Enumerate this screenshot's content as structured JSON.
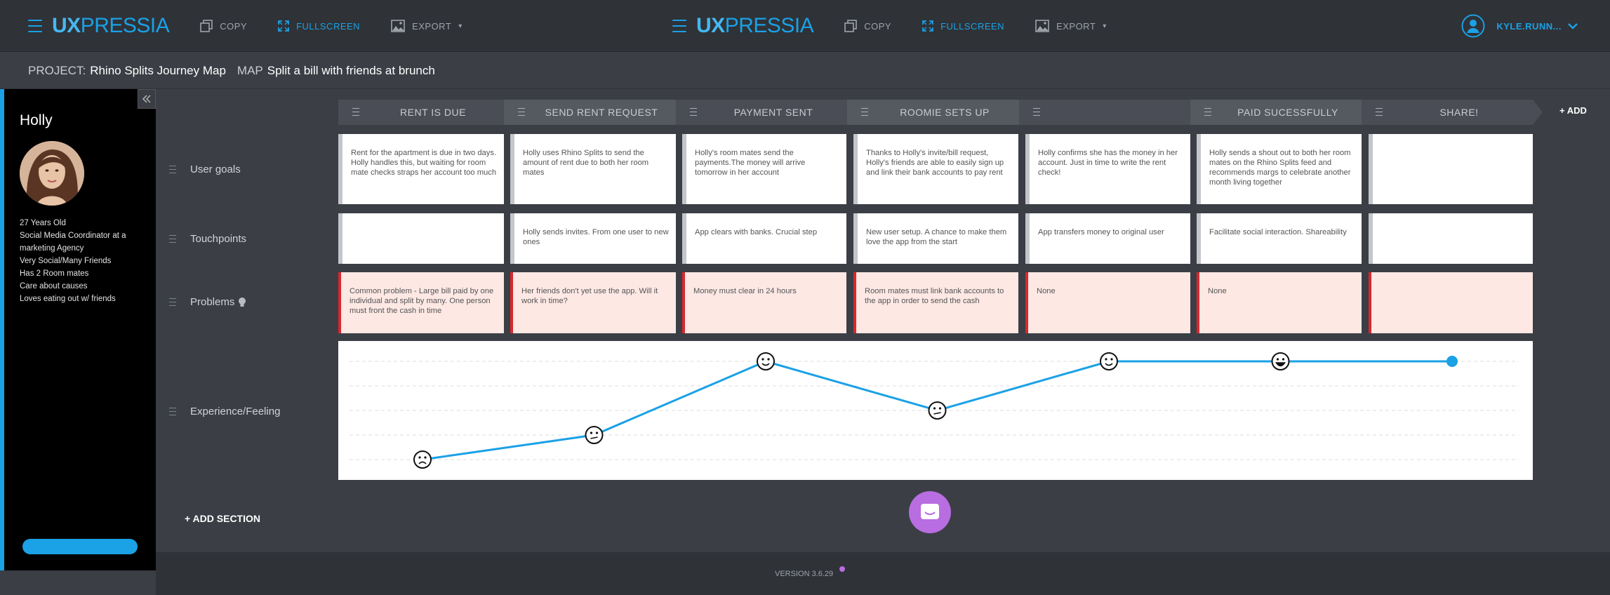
{
  "app": {
    "logo_left": "UX",
    "logo_right": "PRESSIA"
  },
  "toolbar": {
    "copy": "COPY",
    "fullscreen": "FULLSCREEN",
    "export": "EXPORT",
    "export_caret": "▾"
  },
  "user": {
    "name": "KYLE.RUNN...",
    "caret": "⌄"
  },
  "breadcrumb": {
    "project_label": "PROJECT:",
    "project_name": "Rhino Splits Journey Map",
    "map_label": "MAP",
    "map_name": "Split a bill with friends at brunch"
  },
  "persona": {
    "name": "Holly",
    "collapse": "<<",
    "details": [
      "27 Years Old",
      "Social Media Coordinator at a marketing Agency",
      "Very Social/Many Friends",
      "Has 2 Room mates",
      "Care about causes",
      "Loves eating out w/ friends"
    ]
  },
  "stages": [
    "RENT IS DUE",
    "SEND RENT REQUEST",
    "PAYMENT SENT",
    "ROOMIE SETS UP",
    "",
    "PAID SUCESSFULLY",
    "SHARE!"
  ],
  "add_stage": "+ ADD",
  "rows": {
    "goals": {
      "label": "User goals",
      "cells": [
        "Rent for the apartment is due in two days. Holly handles this, but waiting for room mate checks straps her account too much",
        "Holly uses Rhino Splits to send the amount of rent due to both her room mates",
        "Holly's room mates send the payments.The money will arrive tomorrow in her account",
        "Thanks to Holly's invite/bill request, Holly's friends are able to easily sign up and link their bank accounts to pay rent",
        "Holly confirms she has the money in her account. Just in time to write the rent check!",
        "Holly sends a shout out to both her room mates on the Rhino Splits feed and recommends margs to celebrate another month living together",
        ""
      ]
    },
    "touchpoints": {
      "label": "Touchpoints",
      "cells": [
        "",
        "Holly sends invites. From one user to new ones",
        "App clears with banks. Crucial step",
        "New user setup. A chance to make them love the app from the start",
        "App transfers money to original user",
        "Facilitate social interaction. Shareability",
        ""
      ]
    },
    "problems": {
      "label": "Problems",
      "cells": [
        "Common problem - Large bill paid by one individual and split by many. One person must front the cash in time",
        "Her friends don't yet use the app. Will it work in time?",
        "Money must clear in 24 hours",
        "Room mates must link bank accounts to the app in order to send the cash",
        "None",
        "None",
        ""
      ]
    },
    "experience": {
      "label": "Experience/Feeling"
    }
  },
  "chart_data": {
    "type": "line",
    "x": [
      1,
      2,
      3,
      4,
      5,
      6,
      7
    ],
    "ylim": [
      1,
      5
    ],
    "values": [
      1,
      2,
      5,
      3,
      5,
      5,
      5
    ],
    "faces": [
      "sad",
      "neutral",
      "happy",
      "neutral",
      "happy",
      "grin",
      "none"
    ],
    "grid": true,
    "color": "#1aa1e6"
  },
  "add_section": "+ ADD SECTION",
  "footer": {
    "version": "VERSION 3.6.29"
  }
}
